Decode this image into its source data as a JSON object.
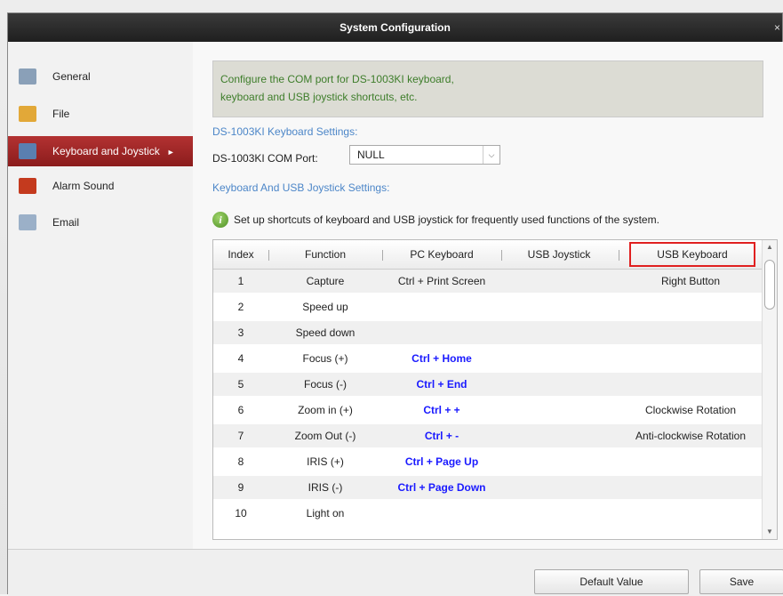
{
  "window": {
    "title": "System Configuration",
    "close": "×"
  },
  "sidebar": {
    "items": [
      {
        "label": "General",
        "icon": "general-icon"
      },
      {
        "label": "File",
        "icon": "file-icon"
      },
      {
        "label": "Keyboard and Joystick",
        "icon": "keyboard-icon",
        "active": true,
        "arrow": "►"
      },
      {
        "label": "Alarm Sound",
        "icon": "alarm-sound-icon"
      },
      {
        "label": "Email",
        "icon": "email-icon"
      }
    ]
  },
  "main": {
    "info_line1": "Configure the COM port for DS-1003KI keyboard,",
    "info_line2": "keyboard and USB joystick shortcuts, etc.",
    "section1": "DS-1003KI Keyboard Settings:",
    "com_label": "DS-1003KI COM Port:",
    "com_value": "NULL",
    "section2": "Keyboard And USB Joystick Settings:",
    "hint": "Set up shortcuts of keyboard and USB joystick for frequently used functions of the system.",
    "hint_icon": "i"
  },
  "table": {
    "headers": [
      "Index",
      "Function",
      "PC Keyboard",
      "USB Joystick",
      "USB Keyboard"
    ],
    "rows": [
      {
        "index": "1",
        "function": "Capture",
        "pc": "Ctrl + Print Screen",
        "joy": "",
        "usb": "Right Button",
        "pc_bold": false
      },
      {
        "index": "2",
        "function": "Speed up",
        "pc": "",
        "joy": "",
        "usb": "",
        "pc_bold": false
      },
      {
        "index": "3",
        "function": "Speed down",
        "pc": "",
        "joy": "",
        "usb": "",
        "pc_bold": false
      },
      {
        "index": "4",
        "function": "Focus (+)",
        "pc": "Ctrl + Home",
        "joy": "",
        "usb": "",
        "pc_bold": true
      },
      {
        "index": "5",
        "function": "Focus (-)",
        "pc": "Ctrl + End",
        "joy": "",
        "usb": "",
        "pc_bold": true
      },
      {
        "index": "6",
        "function": "Zoom in (+)",
        "pc": "Ctrl + +",
        "joy": "",
        "usb": "Clockwise Rotation",
        "pc_bold": true
      },
      {
        "index": "7",
        "function": "Zoom Out (-)",
        "pc": "Ctrl + -",
        "joy": "",
        "usb": "Anti-clockwise Rotation",
        "pc_bold": true
      },
      {
        "index": "8",
        "function": "IRIS (+)",
        "pc": "Ctrl + Page Up",
        "joy": "",
        "usb": "",
        "pc_bold": true
      },
      {
        "index": "9",
        "function": "IRIS (-)",
        "pc": "Ctrl + Page Down",
        "joy": "",
        "usb": "",
        "pc_bold": true
      },
      {
        "index": "10",
        "function": "Light on",
        "pc": "",
        "joy": "",
        "usb": "",
        "pc_bold": false
      }
    ]
  },
  "footer": {
    "default_label": "Default Value",
    "save_label": "Save"
  },
  "colors": {
    "accent": "#a52828",
    "link": "#4c86c8",
    "info_text": "#3d7d2a",
    "key_text": "#1a1aff",
    "highlight": "#e02020"
  }
}
